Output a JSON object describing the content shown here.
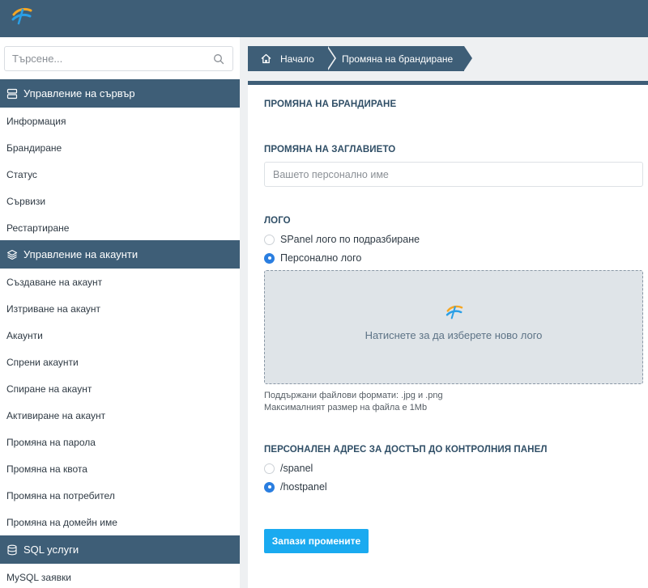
{
  "colors": {
    "brand": "#3e5e77",
    "accent": "#1aaaf0",
    "radio_checked": "#2a7ee0"
  },
  "sidebar": {
    "search": {
      "placeholder": "Търсене...",
      "icon": "search-icon"
    },
    "sections": [
      {
        "title": "Управление на сървър",
        "icon": "server-icon",
        "items": [
          "Информация",
          "Брандиране",
          "Статус",
          "Сървизи",
          "Рестартиране"
        ]
      },
      {
        "title": "Управление на акаунти",
        "icon": "layers-icon",
        "items": [
          "Създаване на акаунт",
          "Изтриване на акаунт",
          "Акаунти",
          "Спрени акаунти",
          "Спиране на акаунт",
          "Активиране на акаунт",
          "Промяна на парола",
          "Промяна на квота",
          "Промяна на потребител",
          "Промяна на домейн име"
        ]
      },
      {
        "title": "SQL услуги",
        "icon": "database-icon",
        "items": [
          "MySQL заявки"
        ]
      }
    ]
  },
  "breadcrumb": {
    "home": "Начало",
    "current": "Промяна на брандиране"
  },
  "main": {
    "page_title": "ПРОМЯНА НА БРАНДИРАНЕ",
    "title_section": {
      "heading": "ПРОМЯНА НА ЗАГЛАВИЕТО",
      "placeholder": "Вашето персонално име",
      "value": ""
    },
    "logo_section": {
      "heading": "ЛОГО",
      "options": [
        {
          "label": "SPanel лого по подразбиране",
          "checked": false
        },
        {
          "label": "Персонално лого",
          "checked": true
        }
      ],
      "dropzone_text": "Натиснете за да изберете ново лого",
      "formats_note": "Поддържани файлови формати: .jpg и .png",
      "size_note": "Максималният размер на файла е 1Mb"
    },
    "url_section": {
      "heading": "ПЕРСОНАЛЕН АДРЕС ЗА ДОСТЪП ДО КОНТРОЛНИЯ ПАНЕЛ",
      "options": [
        {
          "label": "/spanel",
          "checked": false
        },
        {
          "label": "/hostpanel",
          "checked": true
        }
      ]
    },
    "save_label": "Запази промените"
  }
}
